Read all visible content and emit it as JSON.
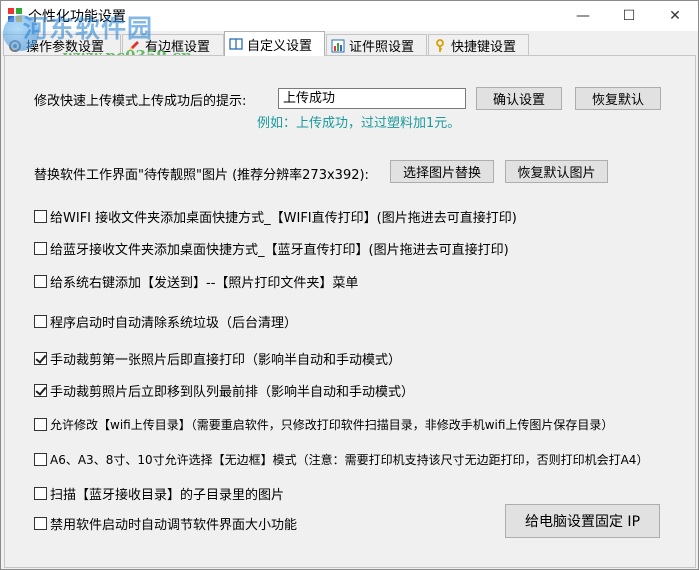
{
  "window": {
    "title": "个性化功能设置",
    "controls": {
      "minimize": "—",
      "maximize": "☐",
      "close": "✕"
    }
  },
  "watermark": {
    "name": "河东软件园",
    "url": "www.pc0359.cn"
  },
  "tabs": [
    {
      "label": "操作参数设置",
      "icon": "gear-icon",
      "active": false
    },
    {
      "label": "有边框设置",
      "icon": "pen-icon",
      "active": false
    },
    {
      "label": "自定义设置",
      "icon": "book-icon",
      "active": true
    },
    {
      "label": "证件照设置",
      "icon": "chart-icon",
      "active": false
    },
    {
      "label": "快捷键设置",
      "icon": "key-icon",
      "active": false
    }
  ],
  "upload_hint": {
    "label": "修改快速上传模式上传成功后的提示:",
    "value": "上传成功",
    "confirm_button": "确认设置",
    "restore_button": "恢复默认",
    "example": "例如：上传成功，过过塑料加1元。"
  },
  "waiting_image": {
    "label": "替换软件工作界面\"待传靓照\"图片 (推荐分辨率273x392):",
    "select_button": "选择图片替换",
    "restore_button": "恢复默认图片"
  },
  "options": [
    {
      "label": "给WIFI 接收文件夹添加桌面快捷方式_【WIFI直传打印】(图片拖进去可直接打印)",
      "checked": false
    },
    {
      "label": "给蓝牙接收文件夹添加桌面快捷方式_【蓝牙直传打印】(图片拖进去可直接打印)",
      "checked": false
    },
    {
      "label": "给系统右键添加【发送到】--【照片打印文件夹】菜单",
      "checked": false
    },
    {
      "label": "程序启动时自动清除系统垃圾（后台清理）",
      "checked": false
    },
    {
      "label": "手动裁剪第一张照片后即直接打印（影响半自动和手动模式）",
      "checked": true
    },
    {
      "label": "手动裁剪照片后立即移到队列最前排（影响半自动和手动模式）",
      "checked": true
    },
    {
      "label": "允许修改【wifi上传目录】（需要重启软件，只修改打印软件扫描目录，非修改手机wifi上传图片保存目录）",
      "checked": false
    },
    {
      "label": "A6、A3、8寸、10寸允许选择【无边框】模式（注意：需要打印机支持该尺寸无边距打印，否则打印机会打A4）",
      "checked": false
    },
    {
      "label": "扫描【蓝牙接收目录】的子目录里的图片",
      "checked": false
    },
    {
      "label": "禁用软件启动时自动调节软件界面大小功能",
      "checked": false
    }
  ],
  "fixed_ip_button": "给电脑设置固定 IP"
}
